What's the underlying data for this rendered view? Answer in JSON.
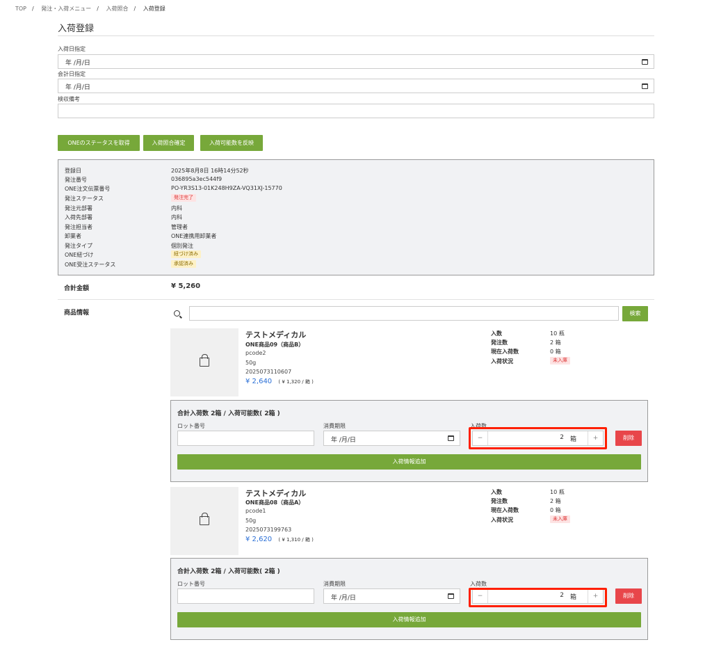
{
  "breadcrumb": [
    "TOP",
    "発注・入荷メニュー",
    "入荷照合",
    "入荷登録"
  ],
  "page_title": "入荷登録",
  "form": {
    "arrival_date_label": "入荷日指定",
    "arrival_date_placeholder": "年 /月/日",
    "accounting_date_label": "会計日指定",
    "accounting_date_placeholder": "年 /月/日",
    "inspection_note_label": "検収備考",
    "inspection_note_value": ""
  },
  "actions": {
    "get_status": "ONEのステータスを取得",
    "confirm": "入荷照合確定",
    "reflect": "入荷可能数を反映"
  },
  "order_info": {
    "rows": [
      {
        "label": "登録日",
        "value": "2025年8月8日 16時14分52秒"
      },
      {
        "label": "発注番号",
        "value": "036895a3ec544f9"
      },
      {
        "label": "ONE注文伝票番号",
        "value": "PO-YR3S13-01K248H9ZA-VQ31XJ-15770"
      },
      {
        "label": "発注ステータス",
        "value": "発注完了",
        "badge": "red"
      },
      {
        "label": "発注元部署",
        "value": "内科"
      },
      {
        "label": "入荷先部署",
        "value": "内科"
      },
      {
        "label": "発注担当者",
        "value": "管理者"
      },
      {
        "label": "卸業者",
        "value": "ONE連携用卸業者"
      },
      {
        "label": "発注タイプ",
        "value": "個別発注"
      },
      {
        "label": "ONE紐づけ",
        "value": "紐づけ済み",
        "badge": "yellow"
      },
      {
        "label": "ONE受注ステータス",
        "value": "承認済み",
        "badge": "yellow"
      }
    ]
  },
  "total": {
    "label": "合計金額",
    "value": "¥ 5,260"
  },
  "products_section": {
    "label": "商品情報",
    "search_button": "検索",
    "search_value": ""
  },
  "products": [
    {
      "maker": "テストメディカル",
      "name": "ONE商品09（商品B）",
      "code": "pcode2",
      "spec": "50g",
      "jan": "2025073110607",
      "price": "¥ 2,640",
      "unit_price": "( ¥ 1,320 / 箱 )",
      "meta": [
        {
          "k": "入数",
          "v": "10 瓶"
        },
        {
          "k": "発注数",
          "v": "2 箱"
        },
        {
          "k": "現在入荷数",
          "v": "0 箱"
        },
        {
          "k": "入荷状況",
          "v": "未入庫",
          "badge": "red"
        }
      ],
      "arrival": {
        "title": "合計入荷数 2箱 / 入荷可能数( 2箱 )",
        "lot_label": "ロット番号",
        "lot_value": "",
        "expiry_label": "消費期限",
        "expiry_placeholder": "年 /月/日",
        "qty_label": "入荷数",
        "qty_value": "2",
        "qty_unit": "箱",
        "minus": "−",
        "plus": "+",
        "delete": "削除",
        "add": "入荷情報追加"
      }
    },
    {
      "maker": "テストメディカル",
      "name": "ONE商品08（商品A）",
      "code": "pcode1",
      "spec": "50g",
      "jan": "2025073199763",
      "price": "¥ 2,620",
      "unit_price": "( ¥ 1,310 / 箱 )",
      "meta": [
        {
          "k": "入数",
          "v": "10 瓶"
        },
        {
          "k": "発注数",
          "v": "2 箱"
        },
        {
          "k": "現在入荷数",
          "v": "0 箱"
        },
        {
          "k": "入荷状況",
          "v": "未入庫",
          "badge": "red"
        }
      ],
      "arrival": {
        "title": "合計入荷数 2箱 / 入荷可能数( 2箱 )",
        "lot_label": "ロット番号",
        "lot_value": "",
        "expiry_label": "消費期限",
        "expiry_placeholder": "年 /月/日",
        "qty_label": "入荷数",
        "qty_value": "2",
        "qty_unit": "箱",
        "minus": "−",
        "plus": "+",
        "delete": "削除",
        "add": "入荷情報追加"
      }
    }
  ]
}
